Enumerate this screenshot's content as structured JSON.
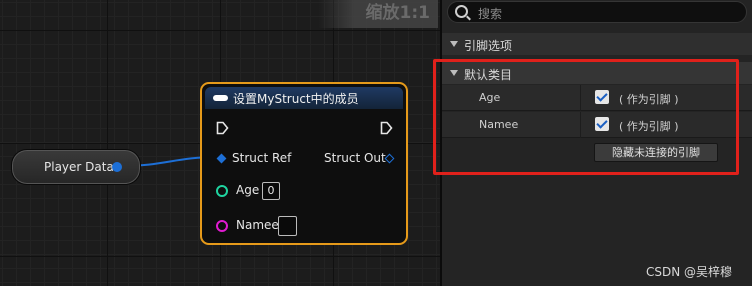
{
  "graph": {
    "zoom_label": "缩放1:1",
    "variable_node": {
      "label": "Player Data"
    },
    "set_node": {
      "title": "设置MyStruct中的成员",
      "struct_ref_label": "Struct Ref",
      "struct_out_label": "Struct Out",
      "age_label": "Age",
      "age_value": "0",
      "namee_label": "Namee",
      "namee_value": ""
    }
  },
  "details": {
    "search_placeholder": "搜索",
    "category_pin_options": "引脚选项",
    "category_default": "默认类目",
    "rows": [
      {
        "label": "Age",
        "checked": true,
        "text": "( 作为引脚 )"
      },
      {
        "label": "Namee",
        "checked": true,
        "text": "( 作为引脚 )"
      }
    ],
    "hide_unconnected_label": "隐藏未连接的引脚"
  },
  "watermark": "CSDN @吴梓穆",
  "colors": {
    "node_border": "#e69a1a",
    "struct_pin": "#1d6fd6",
    "int_pin": "#1fd4a0",
    "string_pin": "#e01bd0",
    "highlight": "#e0211b"
  }
}
